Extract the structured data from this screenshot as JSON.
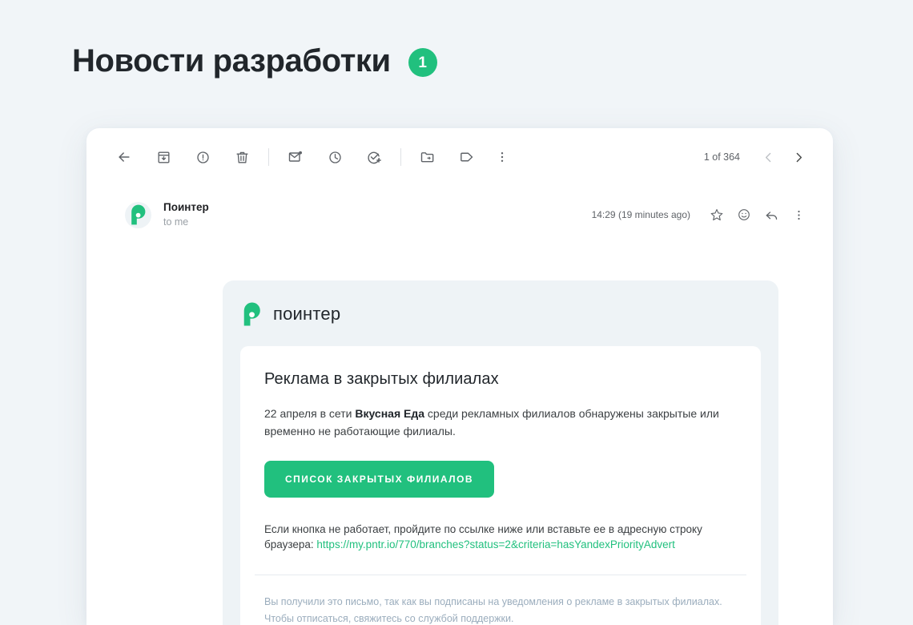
{
  "page": {
    "heading": "Новости разработки",
    "badge": "1",
    "accent_color": "#21c07e",
    "background_color": "#f1f5f8"
  },
  "toolbar": {
    "back_label": "back-arrow",
    "icons": [
      {
        "name": "back-icon",
        "title": "Назад"
      },
      {
        "name": "archive-icon",
        "title": "Архивировать"
      },
      {
        "name": "report-spam-icon",
        "title": "В спам"
      },
      {
        "name": "delete-icon",
        "title": "Удалить"
      },
      {
        "name": "mark-unread-icon",
        "title": "Отметить как непрочитанное"
      },
      {
        "name": "snooze-icon",
        "title": "Отложить"
      },
      {
        "name": "add-to-tasks-icon",
        "title": "Добавить в задачи"
      },
      {
        "name": "move-to-icon",
        "title": "Переместить"
      },
      {
        "name": "label-icon",
        "title": "Ярлыки"
      },
      {
        "name": "more-options-icon",
        "title": "Ещё"
      }
    ],
    "pager_text": "1 of 364",
    "prev_label": "Предыдущее",
    "next_label": "Следующее"
  },
  "sender": {
    "avatar_letter": "П",
    "name": "Поинтер",
    "to": "to me",
    "time": "14:29 (19 minutes ago)",
    "star_label": "Отметить звёздочкой",
    "emoji_label": "Добавить реакцию",
    "reply_label": "Ответить",
    "more_label": "Ещё"
  },
  "email": {
    "brand": "поинтер",
    "title": "Реклама в закрытых филиалах",
    "paragraph_prefix": "22 апреля в сети ",
    "paragraph_bold": "Вкусная Еда",
    "paragraph_suffix": " среди рекламных филиалов обнаружены закрытые или временно не работающие филиалы.",
    "cta_label": "СПИСОК ЗАКРЫТЫХ ФИЛИАЛОВ",
    "fallback_text": "Если кнопка не работает, пройдите по ссылке ниже или вставьте ее в адресную строку браузера: ",
    "fallback_link": "https://my.pntr.io/770/branches?status=2&criteria=hasYandexPriorityAdvert",
    "footer": "Вы получили это письмо, так как вы подписаны на уведомления о рекламе в закрытых филиалах. Чтобы отписаться, свяжитесь со службой поддержки."
  }
}
